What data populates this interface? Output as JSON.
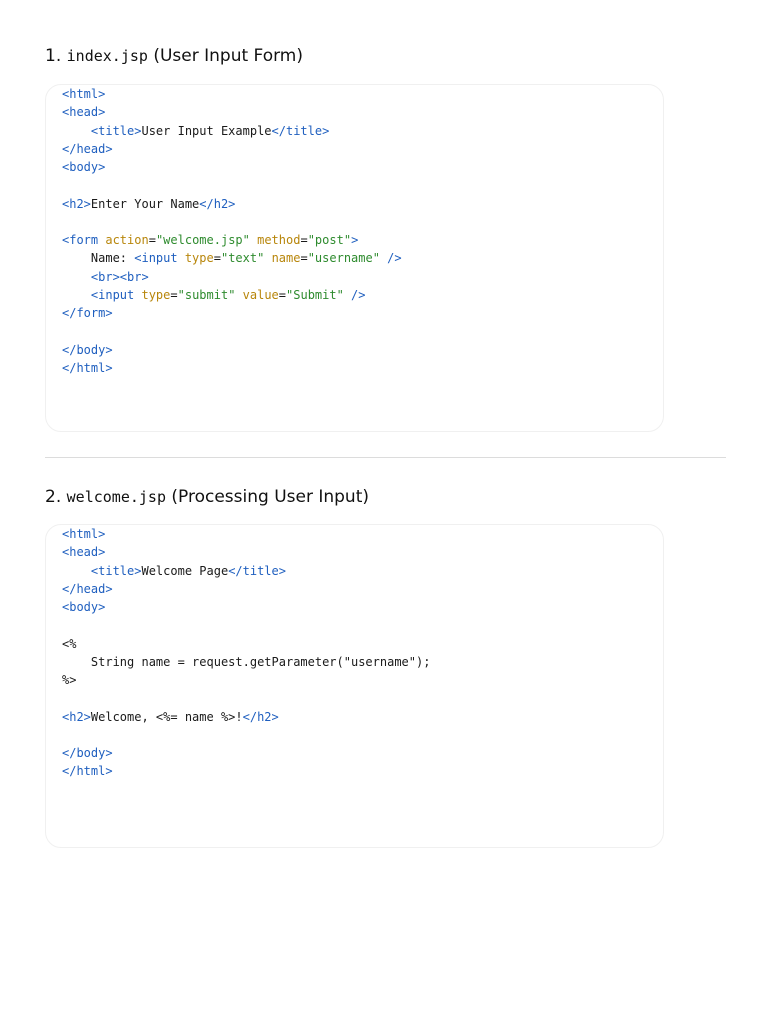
{
  "sections": [
    {
      "number": "1.",
      "filename": "index.jsp",
      "description": "(User Input Form)",
      "code": [
        [
          {
            "t": "<html>",
            "c": "tag"
          }
        ],
        [
          {
            "t": "<head>",
            "c": "tag"
          }
        ],
        [
          {
            "t": "    "
          },
          {
            "t": "<title>",
            "c": "tag"
          },
          {
            "t": "User Input Example"
          },
          {
            "t": "</title>",
            "c": "tag"
          }
        ],
        [
          {
            "t": "</head>",
            "c": "tag"
          }
        ],
        [
          {
            "t": "<body>",
            "c": "tag"
          }
        ],
        [],
        [
          {
            "t": "<h2>",
            "c": "tag"
          },
          {
            "t": "Enter Your Name"
          },
          {
            "t": "</h2>",
            "c": "tag"
          }
        ],
        [],
        [
          {
            "t": "<form ",
            "c": "tag"
          },
          {
            "t": "action",
            "c": "attr"
          },
          {
            "t": "="
          },
          {
            "t": "\"welcome.jsp\"",
            "c": "str"
          },
          {
            "t": " "
          },
          {
            "t": "method",
            "c": "attr"
          },
          {
            "t": "="
          },
          {
            "t": "\"post\"",
            "c": "str"
          },
          {
            "t": ">",
            "c": "tag"
          }
        ],
        [
          {
            "t": "    Name: "
          },
          {
            "t": "<input ",
            "c": "tag"
          },
          {
            "t": "type",
            "c": "attr"
          },
          {
            "t": "="
          },
          {
            "t": "\"text\"",
            "c": "str"
          },
          {
            "t": " "
          },
          {
            "t": "name",
            "c": "attr"
          },
          {
            "t": "="
          },
          {
            "t": "\"username\"",
            "c": "str"
          },
          {
            "t": " />",
            "c": "tag"
          }
        ],
        [
          {
            "t": "    "
          },
          {
            "t": "<br><br>",
            "c": "tag"
          }
        ],
        [
          {
            "t": "    "
          },
          {
            "t": "<input ",
            "c": "tag"
          },
          {
            "t": "type",
            "c": "attr"
          },
          {
            "t": "="
          },
          {
            "t": "\"submit\"",
            "c": "str"
          },
          {
            "t": " "
          },
          {
            "t": "value",
            "c": "attr"
          },
          {
            "t": "="
          },
          {
            "t": "\"Submit\"",
            "c": "str"
          },
          {
            "t": " />",
            "c": "tag"
          }
        ],
        [
          {
            "t": "</form>",
            "c": "tag"
          }
        ],
        [],
        [
          {
            "t": "</body>",
            "c": "tag"
          }
        ],
        [
          {
            "t": "</html>",
            "c": "tag"
          }
        ]
      ]
    },
    {
      "number": "2.",
      "filename": "welcome.jsp",
      "description": "(Processing User Input)",
      "code": [
        [
          {
            "t": "<html>",
            "c": "tag"
          }
        ],
        [
          {
            "t": "<head>",
            "c": "tag"
          }
        ],
        [
          {
            "t": "    "
          },
          {
            "t": "<title>",
            "c": "tag"
          },
          {
            "t": "Welcome Page"
          },
          {
            "t": "</title>",
            "c": "tag"
          }
        ],
        [
          {
            "t": "</head>",
            "c": "tag"
          }
        ],
        [
          {
            "t": "<body>",
            "c": "tag"
          }
        ],
        [],
        [
          {
            "t": "<%"
          }
        ],
        [
          {
            "t": "    String name = request.getParameter(\"username\");"
          }
        ],
        [
          {
            "t": "%>"
          }
        ],
        [],
        [
          {
            "t": "<h2>",
            "c": "tag"
          },
          {
            "t": "Welcome, <%= name %>!"
          },
          {
            "t": "</h2>",
            "c": "tag"
          }
        ],
        [],
        [
          {
            "t": "</body>",
            "c": "tag"
          }
        ],
        [
          {
            "t": "</html>",
            "c": "tag"
          }
        ]
      ]
    }
  ]
}
